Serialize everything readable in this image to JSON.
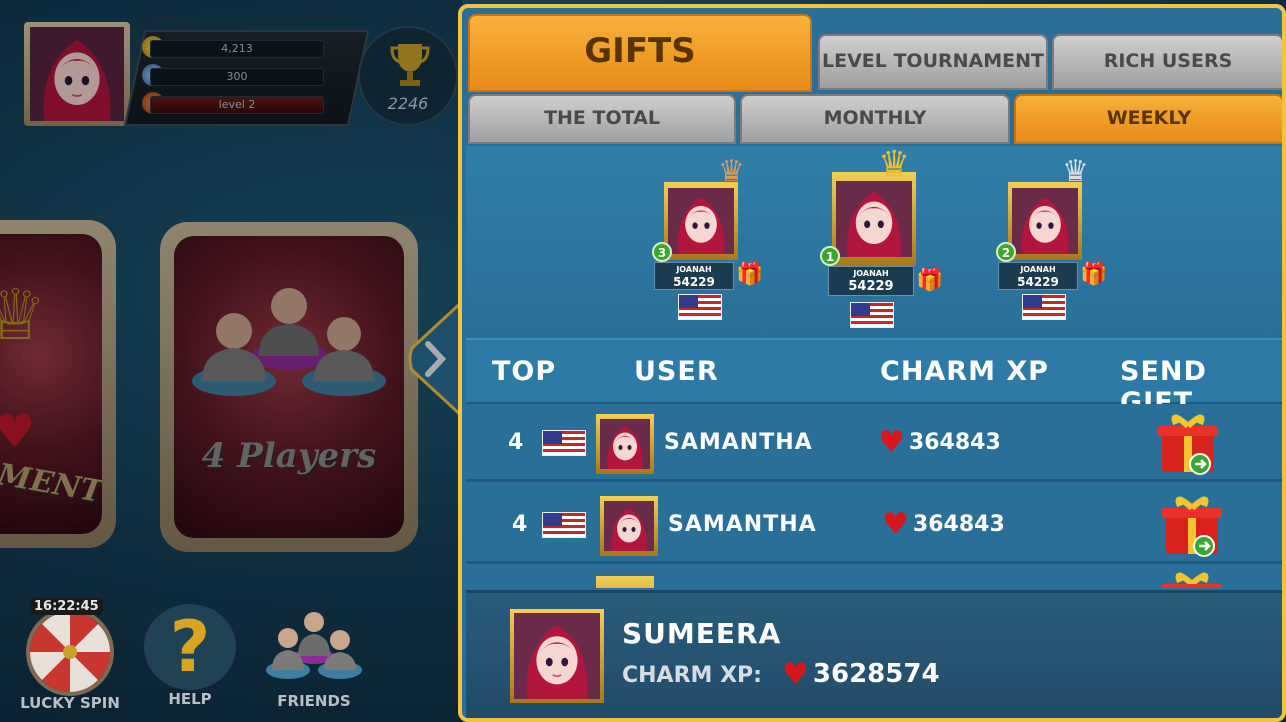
{
  "player": {
    "coins": "4,213",
    "gems": "300",
    "level": "level 2",
    "trophies": "2246",
    "timer": "16:22:45"
  },
  "modes": {
    "tournament_partial": "AMENT",
    "four_players": "4 Players"
  },
  "bottom_nav": {
    "lucky_spin": "LUCKY SPIN",
    "help": "HELP",
    "friends": "FRIENDS"
  },
  "tabs": {
    "gifts": "GIFTS",
    "level_tournament": "LEVEL TOURNAMENT",
    "rich_users": "RICH USERS"
  },
  "subtabs": {
    "total": "THE TOTAL",
    "monthly": "MONTHLY",
    "weekly": "WEEKLY"
  },
  "podium": [
    {
      "rank": "3",
      "name": "JOANAH",
      "score": "54229",
      "crown": "bronze"
    },
    {
      "rank": "1",
      "name": "JOANAH",
      "score": "54229",
      "crown": "gold"
    },
    {
      "rank": "2",
      "name": "JOANAH",
      "score": "54229",
      "crown": "silver"
    }
  ],
  "columns": {
    "top": "TOP",
    "user": "USER",
    "charm_xp": "CHARM XP",
    "send_gift": "SEND GIFT"
  },
  "rows": [
    {
      "rank": "4",
      "name": "SAMANTHA",
      "xp": "364843"
    },
    {
      "rank": "4",
      "name": "SAMANTHA",
      "xp": "364843"
    }
  ],
  "me": {
    "name": "SUMEERA",
    "label": "CHARM XP:",
    "xp": "3628574"
  },
  "colors": {
    "panel_border": "#f0c43e",
    "active_tab": "#f2a12a",
    "panel_bg": "#2a6f98"
  }
}
